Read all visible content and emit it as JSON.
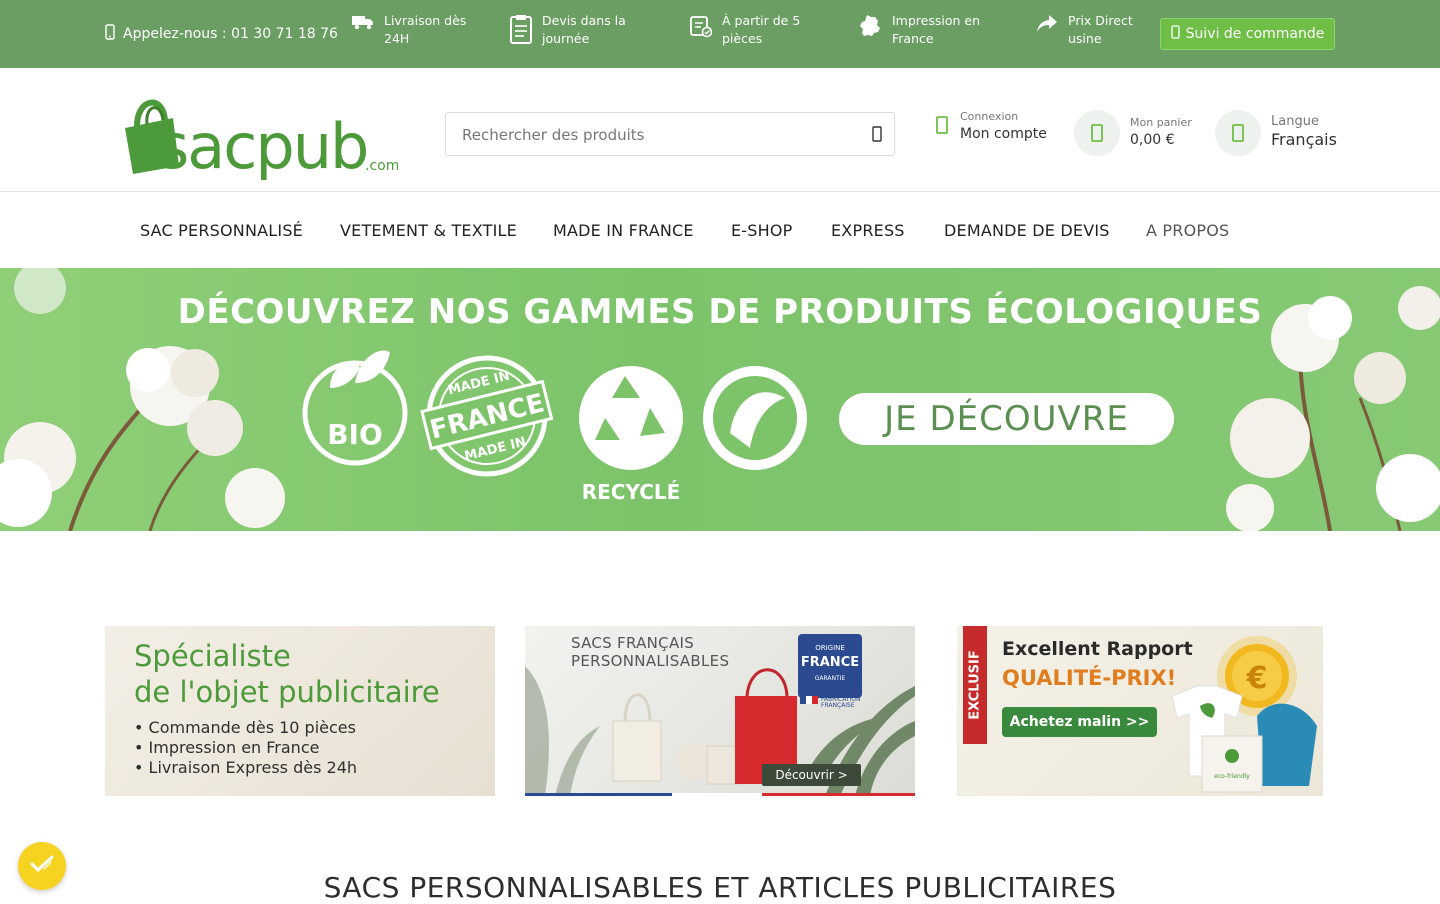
{
  "topbar": {
    "phone": "Appelez-nous : 01 30 71 18 76",
    "features": [
      {
        "icon": "truck-icon",
        "text": "Livraison dès 24H"
      },
      {
        "icon": "clipboard-icon",
        "text": "Devis dans la journée"
      },
      {
        "icon": "quantity-icon",
        "text": "À partir de 5 pièces"
      },
      {
        "icon": "france-map-icon",
        "text": "Impression en France"
      },
      {
        "icon": "share-arrow-icon",
        "text": "Prix Direct usine"
      }
    ],
    "track_button": "Suivi de commande"
  },
  "header": {
    "logo_text": "sacpub",
    "logo_suffix": ".com",
    "search_placeholder": "Rechercher des produits",
    "account": {
      "small": "Connexion",
      "big": "Mon compte"
    },
    "cart": {
      "small": "Mon panier",
      "big": "0,00 €"
    },
    "language": {
      "small": "Langue",
      "big": "Français"
    }
  },
  "nav": {
    "items": [
      {
        "label": "SAC PERSONNALISÉ"
      },
      {
        "label": "VETEMENT & TEXTILE"
      },
      {
        "label": "MADE IN FRANCE"
      },
      {
        "label": "E-SHOP"
      },
      {
        "label": "EXPRESS"
      },
      {
        "label": "DEMANDE DE DEVIS"
      },
      {
        "label": "A PROPOS"
      }
    ]
  },
  "hero": {
    "title": "DÉCOUVREZ NOS GAMMES DE PRODUITS ÉCOLOGIQUES",
    "badges": {
      "bio": "BIO",
      "made_in": "MADE IN",
      "france": "FRANCE",
      "recycle": "RECYCLÉ"
    },
    "cta": "JE DÉCOUVRE"
  },
  "cards": {
    "c1": {
      "title_line1": "Spécialiste",
      "title_line2": "de l'objet publicitaire",
      "bullets": [
        "• Commande dès 10 pièces",
        "• Impression en France",
        "• Livraison Express dès 24h"
      ]
    },
    "c2": {
      "title_line1": "SACS FRANÇAIS",
      "title_line2": "PERSONNALISABLES",
      "badge_origin": "ORIGINE",
      "badge_france": "FRANCE",
      "badge_garantie": "GARANTIE",
      "badge_fab1": "FABRICATION",
      "badge_fab2": "FRANÇAISE",
      "button": "Découvrir >"
    },
    "c3": {
      "exclusive": "EXCLUSIF",
      "line1": "Excellent Rapport",
      "line2": "QUALITÉ-PRIX!",
      "button": "Achetez malin >>",
      "coin": "€",
      "bag_label": "eco-friendly"
    }
  },
  "section": {
    "title": "SACS PERSONNALISABLES ET ARTICLES PUBLICITAIRES"
  },
  "colors": {
    "topbar": "#6a9e62",
    "brand_green": "#4c9a3a",
    "accent_green": "#6fbe46",
    "cookie": "#f5d320"
  }
}
